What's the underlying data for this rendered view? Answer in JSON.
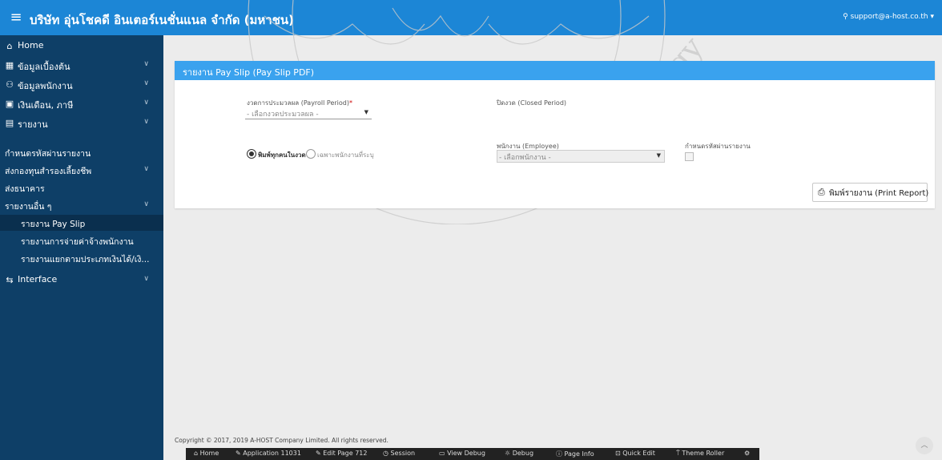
{
  "colors": {
    "topbar": "#1c86d6",
    "sidebar": "#0e3f67",
    "panel_header": "#3aa2ee"
  },
  "topbar": {
    "menu_icon": "hamburger-icon",
    "title": "บริษัท อุ่นโชคดี อินเตอร์เนชั่นแนล จำกัด (มหาชน)",
    "user": "support@a-host.co.th ▾"
  },
  "sidebar": {
    "items": [
      {
        "icon": "home-icon",
        "label": "Home"
      },
      {
        "icon": "grid-icon",
        "label": "ข้อมูลเบื้องต้น"
      },
      {
        "icon": "users-icon",
        "label": "ข้อมูลพนักงาน"
      },
      {
        "icon": "money-icon",
        "label": "เงินเดือน, ภาษี"
      },
      {
        "icon": "report-icon",
        "label": "รายงาน"
      }
    ],
    "report_sub": [
      "กำหนดรหัสผ่านรายงาน",
      "ส่งกองทุนสำรองเลี้ยงชีพ",
      "ส่งธนาคาร",
      "รายงานอื่น ๆ"
    ],
    "other_reports": [
      "รายงาน Pay Slip",
      "รายงานการจ่ายค่าจ้างพนักงาน",
      "รายงานแยกตามประเภทเงินได้/เงิ..."
    ],
    "interface": "Interface"
  },
  "panel": {
    "title": "รายงาน Pay Slip (Pay Slip PDF)",
    "payroll_label": "งวดการประมวลผล (Payroll Period)",
    "payroll_placeholder": "- เลือกงวดประมวลผล -",
    "closed_label": "ปิดงวด (Closed Period)",
    "radio_all": "พิมพ์ทุกคนในงวด",
    "radio_select": "เฉพาะพนักงานที่ระบุ",
    "employee_label": "พนักงาน (Employee)",
    "employee_placeholder": "- เลือกพนักงาน -",
    "password_label": "กำหนดรหัสผ่านรายงาน",
    "print_button": "พิมพ์รายงาน (Print Report)"
  },
  "footer": {
    "copyright": "Copyright © 2017, 2019 A-HOST Company Limited. All rights reserved."
  },
  "devbar": [
    "Home",
    "Application 11031",
    "Edit Page 712",
    "Session",
    "View Debug",
    "Debug",
    "Page Info",
    "Quick Edit",
    "Theme Roller"
  ]
}
